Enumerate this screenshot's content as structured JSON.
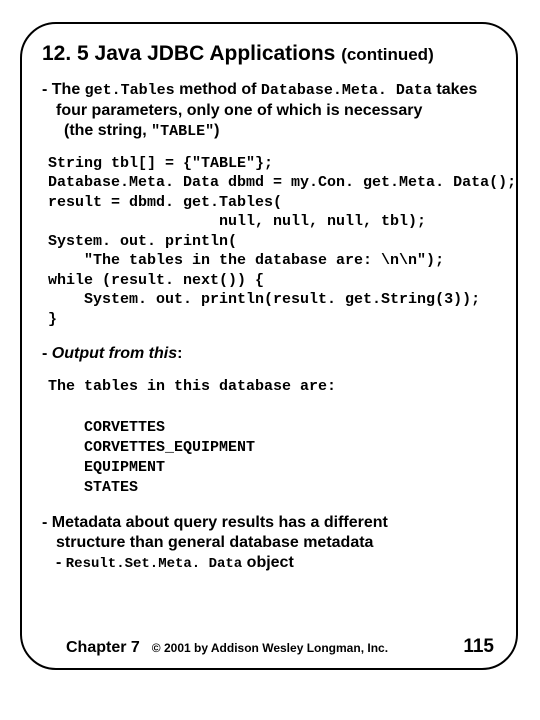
{
  "title": {
    "main": "12. 5 Java JDBC Applications",
    "cont": "(continued)"
  },
  "bullet1": {
    "dash": "-",
    "t1": "The ",
    "code1": "get.Tables",
    "t2": " method of ",
    "code2": "Database.Meta. Data",
    "t3": " takes",
    "line2": "four parameters, only one of which is necessary",
    "line3a": "(the string, ",
    "code3": "\"TABLE\"",
    "line3b": ")"
  },
  "code": "String tbl[] = {\"TABLE\"};\nDatabase.Meta. Data dbmd = my.Con. get.Meta. Data();\nresult = dbmd. get.Tables(\n                   null, null, null, tbl);\nSystem. out. println(\n    \"The tables in the database are: \\n\\n\");\nwhile (result. next()) {\n    System. out. println(result. get.String(3));\n}",
  "outlabel": {
    "dash": "-",
    "text": "Output from this",
    "colon": ":"
  },
  "output": "The tables in this database are:\n\n    CORVETTES\n    CORVETTES_EQUIPMENT\n    EQUIPMENT\n    STATES",
  "bullet2": {
    "dash": "-",
    "line1": "Metadata about query results has a different",
    "line2": "structure than general database metadata",
    "subdash": "-",
    "code": "Result.Set.Meta. Data",
    "tail": " object"
  },
  "footer": {
    "chapter": "Chapter 7",
    "copy": "© 2001 by Addison Wesley Longman, Inc.",
    "pageno": "115"
  }
}
